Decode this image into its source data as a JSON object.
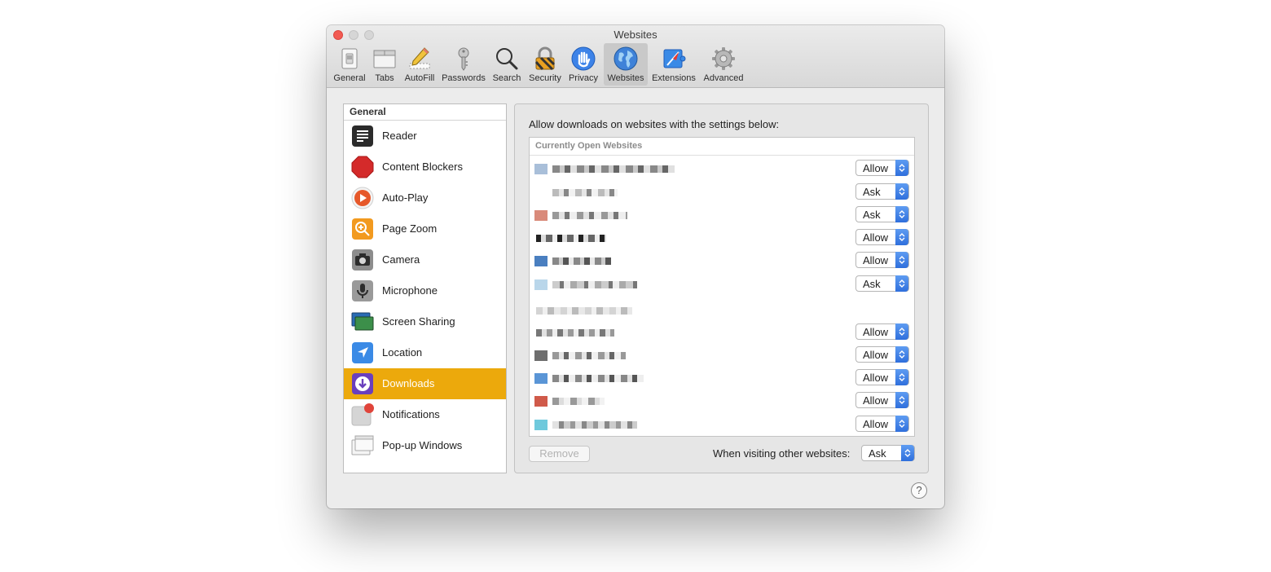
{
  "window": {
    "title": "Websites"
  },
  "toolbar": {
    "items": [
      {
        "label": "General",
        "icon": "general-switch-icon"
      },
      {
        "label": "Tabs",
        "icon": "tabs-icon"
      },
      {
        "label": "AutoFill",
        "icon": "pencil-icon"
      },
      {
        "label": "Passwords",
        "icon": "key-icon"
      },
      {
        "label": "Search",
        "icon": "magnifier-icon"
      },
      {
        "label": "Security",
        "icon": "padlock-icon"
      },
      {
        "label": "Privacy",
        "icon": "hand-icon"
      },
      {
        "label": "Websites",
        "icon": "globe-icon",
        "active": true
      },
      {
        "label": "Extensions",
        "icon": "extensions-puzzle-icon"
      },
      {
        "label": "Advanced",
        "icon": "gear-icon"
      }
    ]
  },
  "sidebar": {
    "header": "General",
    "items": [
      {
        "label": "Reader",
        "icon": "reader-icon"
      },
      {
        "label": "Content Blockers",
        "icon": "stop-sign-icon"
      },
      {
        "label": "Auto-Play",
        "icon": "play-icon"
      },
      {
        "label": "Page Zoom",
        "icon": "zoom-icon"
      },
      {
        "label": "Camera",
        "icon": "camera-icon"
      },
      {
        "label": "Microphone",
        "icon": "microphone-icon"
      },
      {
        "label": "Screen Sharing",
        "icon": "screen-sharing-icon"
      },
      {
        "label": "Location",
        "icon": "location-arrow-icon"
      },
      {
        "label": "Downloads",
        "icon": "downloads-icon",
        "selected": true
      },
      {
        "label": "Notifications",
        "icon": "notifications-icon"
      },
      {
        "label": "Pop-up Windows",
        "icon": "popup-windows-icon"
      }
    ]
  },
  "panel": {
    "description": "Allow downloads on websites with the settings below:",
    "table_header": "Currently Open Websites",
    "rows": [
      {
        "setting": "Allow"
      },
      {
        "setting": "Ask"
      },
      {
        "setting": "Ask"
      },
      {
        "setting": "Allow"
      },
      {
        "setting": "Allow"
      },
      {
        "setting": "Ask"
      },
      {
        "setting": ""
      },
      {
        "setting": "Allow"
      },
      {
        "setting": "Allow"
      },
      {
        "setting": "Allow"
      },
      {
        "setting": "Allow"
      },
      {
        "setting": "Allow"
      }
    ],
    "remove_label": "Remove",
    "other_label": "When visiting other websites:",
    "other_value": "Ask"
  },
  "help": {
    "label": "?"
  },
  "colors": {
    "selection": "#eca90c",
    "popup_accent": "#2f6fdc",
    "close": "#f25a52"
  }
}
